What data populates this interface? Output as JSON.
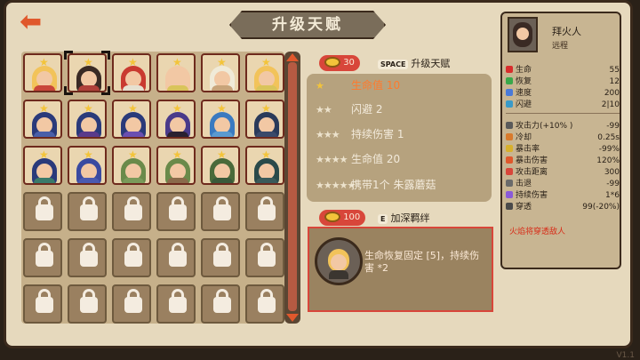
{
  "header": {
    "title": "升级天赋",
    "back_icon": "back-arrow-icon"
  },
  "colors": {
    "accent": "#e0582c",
    "highlight": "#d8463a",
    "gold": "#f3c43a",
    "active_text": "#ff7a2c"
  },
  "roster": {
    "portraits": [
      {
        "hair": "#f2c35a",
        "robe": "#c9463a"
      },
      {
        "hair": "#3a2a24",
        "robe": "#b0403a"
      },
      {
        "hair": "#c93a30",
        "robe": "#e6e0d0"
      },
      {
        "hair": "#f2c8a4",
        "robe": "#d9c45a"
      },
      {
        "hair": "#f0ead8",
        "robe": "#c8a47a"
      },
      {
        "hair": "#f2c35a",
        "robe": "#d9c45a"
      },
      {
        "hair": "#2a3a7a",
        "robe": "#4a5fa8"
      },
      {
        "hair": "#2a3a7a",
        "robe": "#5a3a8a"
      },
      {
        "hair": "#2a3a7a",
        "robe": "#6a4fb0"
      },
      {
        "hair": "#4a3a8a",
        "robe": "#2a2030"
      },
      {
        "hair": "#3a7ac0",
        "robe": "#5a9ad0"
      },
      {
        "hair": "#2a3a5a",
        "robe": "#3a4a6a"
      },
      {
        "hair": "#2a3a7a",
        "robe": "#3a7a6a"
      },
      {
        "hair": "#3a4aa0",
        "robe": "#4a5ab0"
      },
      {
        "hair": "#6a8a4a",
        "robe": "#7a9a5a"
      },
      {
        "hair": "#6a8a4a",
        "robe": "#8a6a4a"
      },
      {
        "hair": "#4a6a3a",
        "robe": "#3a5a3a"
      },
      {
        "hair": "#2a4a4a",
        "robe": "#3a5a5a"
      }
    ],
    "locked_count": 18
  },
  "upgrade": {
    "cost": "30",
    "key": "SPACE",
    "label": "升级天赋"
  },
  "talents": [
    {
      "stars": "★",
      "label": "生命值 10",
      "state": "active"
    },
    {
      "stars": "★★",
      "label": "闪避 2",
      "state": "locked"
    },
    {
      "stars": "★★★",
      "label": "持续伤害 1",
      "state": "locked"
    },
    {
      "stars": "★★★★",
      "label": "生命值 20",
      "state": "locked"
    },
    {
      "stars": "★★★★★",
      "label": "携带1个 朱露蘑菇",
      "state": "locked"
    }
  ],
  "bond": {
    "cost": "100",
    "key": "E",
    "label": "加深羁绊",
    "description": "生命恢复固定 [5]，持续伤害 *2"
  },
  "hero": {
    "name": "拜火人",
    "type": "远程",
    "base_stats": [
      {
        "icon": "heart-icon",
        "color": "#d82c2c",
        "label": "生命",
        "value": "55"
      },
      {
        "icon": "regen-icon",
        "color": "#3aa84a",
        "label": "恢复",
        "value": "12"
      },
      {
        "icon": "speed-icon",
        "color": "#4a7ad8",
        "label": "速度",
        "value": "200"
      },
      {
        "icon": "dodge-icon",
        "color": "#3a9ac8",
        "label": "闪避",
        "value": "2|10"
      }
    ],
    "combat_stats": [
      {
        "icon": "sword-icon",
        "color": "#5a5a5a",
        "label": "攻击力(+10% )",
        "value": "-99"
      },
      {
        "icon": "cooldown-icon",
        "color": "#d87a2c",
        "label": "冷却",
        "value": "0.25s"
      },
      {
        "icon": "crit-rate-icon",
        "color": "#d8b02c",
        "label": "暴击率",
        "value": "-99%"
      },
      {
        "icon": "crit-damage-icon",
        "color": "#e0582c",
        "label": "暴击伤害",
        "value": "120%"
      },
      {
        "icon": "range-icon",
        "color": "#d8463a",
        "label": "攻击距离",
        "value": "300"
      },
      {
        "icon": "knockback-icon",
        "color": "#6a6a6a",
        "label": "击退",
        "value": "-99"
      },
      {
        "icon": "dot-icon",
        "color": "#8a5ad8",
        "label": "持续伤害",
        "value": "1*6"
      },
      {
        "icon": "pierce-icon",
        "color": "#4a4a4a",
        "label": "穿透",
        "value": "99(-20%)"
      }
    ],
    "note": "火焰将穿透敌人"
  },
  "version": "V1.1"
}
